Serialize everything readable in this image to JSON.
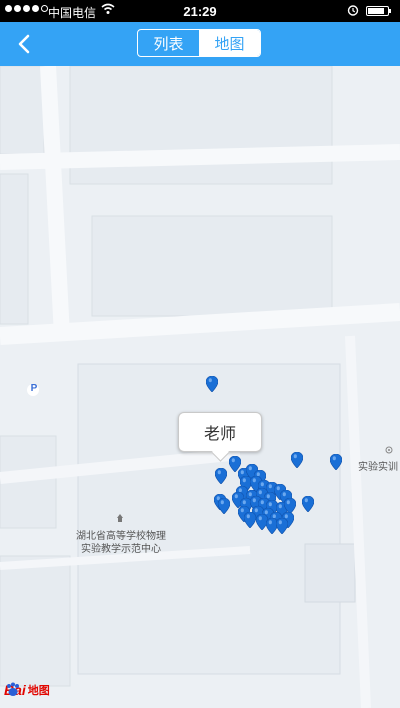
{
  "status_bar": {
    "carrier": "中国电信",
    "time": "21:29",
    "battery_level": 0.85
  },
  "nav": {
    "back_icon": "chevron-left-icon",
    "tabs": [
      {
        "label": "列表",
        "selected": false
      },
      {
        "label": "地图",
        "selected": true
      }
    ]
  },
  "map": {
    "callout_label": "老师",
    "poi": {
      "line1": "湖北省高等学校物理",
      "line2": "实验教学示范中心"
    },
    "right_label": "实验实训",
    "parking_label": "P",
    "marker_color": "#1a6fd6"
  },
  "branding": {
    "logo_bai": "Bai",
    "logo_map": "地图"
  }
}
